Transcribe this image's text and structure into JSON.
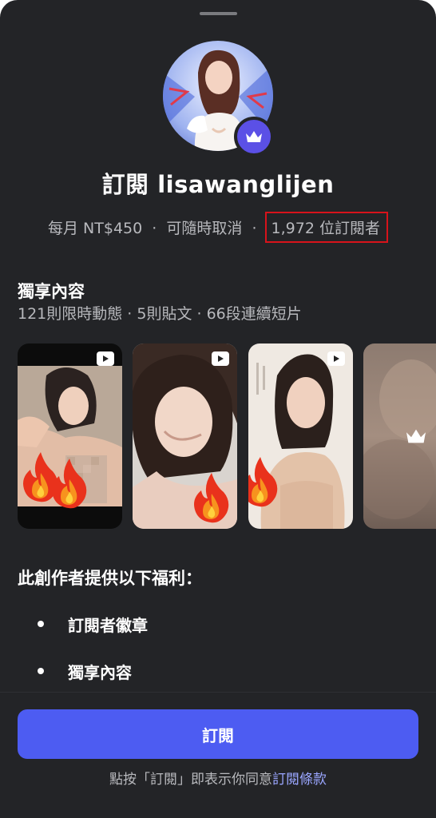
{
  "header": {
    "title": "訂閱 lisawanglijen"
  },
  "summary": {
    "price": "每月 NT$450",
    "cancel": "可隨時取消",
    "subscribers": "1,972 位訂閱者",
    "separator": "·"
  },
  "exclusive": {
    "title": "獨享內容",
    "stats": "121則限時動態 · 5則貼文 · 66段連續短片",
    "thumbnails": [
      {
        "kind": "video",
        "has_play_icon": true,
        "overlay": "fire-emoji"
      },
      {
        "kind": "video",
        "has_play_icon": true,
        "overlay": "fire-emoji"
      },
      {
        "kind": "video",
        "has_play_icon": true,
        "overlay": "fire-emoji"
      },
      {
        "kind": "locked",
        "has_play_icon": false,
        "overlay": "crown-icon"
      }
    ]
  },
  "benefits": {
    "title": "此創作者提供以下福利：",
    "items": [
      "訂閱者徽章",
      "獨享內容"
    ]
  },
  "actions": {
    "subscribe_label": "訂閱"
  },
  "footer": {
    "terms_prefix": "點按「訂閱」即表示你同意",
    "terms_link": "訂閱條款"
  },
  "colors": {
    "background": "#232427",
    "accent_button": "#4d5cf2",
    "crown_badge": "#5b50e6",
    "highlight_box": "#d8131b",
    "link": "#9aa6ff"
  }
}
